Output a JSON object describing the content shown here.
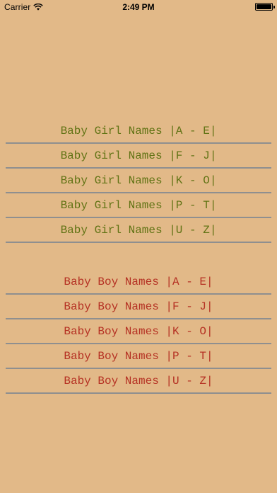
{
  "status_bar": {
    "carrier": "Carrier",
    "time": "2:49 PM",
    "wifi_icon": "wifi-icon",
    "battery_icon": "battery-icon"
  },
  "colors": {
    "background": "#e2b988",
    "girl_text": "#617314",
    "boy_text": "#b53123",
    "separator": "#8f8f8f"
  },
  "girl_names": {
    "items": [
      {
        "label": "Baby Girl Names |A - E|"
      },
      {
        "label": "Baby Girl Names |F - J|"
      },
      {
        "label": "Baby Girl Names |K - O|"
      },
      {
        "label": "Baby Girl Names |P - T|"
      },
      {
        "label": "Baby Girl Names |U - Z|"
      }
    ]
  },
  "boy_names": {
    "items": [
      {
        "label": "Baby Boy Names |A - E|"
      },
      {
        "label": "Baby Boy Names |F - J|"
      },
      {
        "label": "Baby Boy Names |K - O|"
      },
      {
        "label": "Baby Boy Names |P - T|"
      },
      {
        "label": "Baby Boy Names |U - Z|"
      }
    ]
  }
}
